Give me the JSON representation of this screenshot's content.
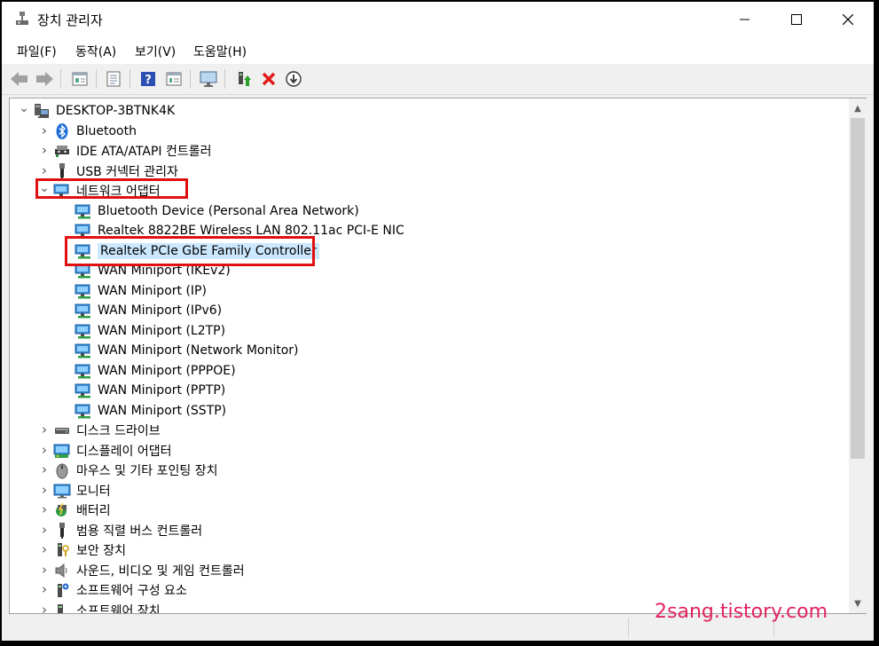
{
  "window": {
    "title": "장치 관리자"
  },
  "menu": [
    "파일(F)",
    "동작(A)",
    "보기(V)",
    "도움말(H)"
  ],
  "toolbar": [
    "back-icon",
    "forward-icon",
    "properties-icon",
    "device-list-icon",
    "help-icon",
    "view-icon",
    "monitor-scan-icon",
    "update-driver-icon",
    "uninstall-icon",
    "disable-icon"
  ],
  "tree": {
    "root": "DESKTOP-3BTNK4K",
    "items": [
      {
        "label": "Bluetooth",
        "level": 1,
        "icon": "bluetooth-icon",
        "expanded": false
      },
      {
        "label": "IDE ATA/ATAPI 컨트롤러",
        "level": 1,
        "icon": "ide-controller-icon",
        "expanded": false
      },
      {
        "label": "USB 커넥터 관리자",
        "level": 1,
        "icon": "usb-connector-icon",
        "expanded": false
      },
      {
        "label": "네트워크 어댑터",
        "level": 1,
        "icon": "network-adapter-icon",
        "expanded": true
      },
      {
        "label": "Bluetooth Device (Personal Area Network)",
        "level": 2,
        "icon": "network-adapter-icon"
      },
      {
        "label": "Realtek 8822BE Wireless LAN 802.11ac PCI-E NIC",
        "level": 2,
        "icon": "network-adapter-icon"
      },
      {
        "label": "Realtek PCIe GbE Family Controller",
        "level": 2,
        "icon": "network-adapter-icon",
        "selected": true
      },
      {
        "label": "WAN Miniport (IKEv2)",
        "level": 2,
        "icon": "network-adapter-icon"
      },
      {
        "label": "WAN Miniport (IP)",
        "level": 2,
        "icon": "network-adapter-icon"
      },
      {
        "label": "WAN Miniport (IPv6)",
        "level": 2,
        "icon": "network-adapter-icon"
      },
      {
        "label": "WAN Miniport (L2TP)",
        "level": 2,
        "icon": "network-adapter-icon"
      },
      {
        "label": "WAN Miniport (Network Monitor)",
        "level": 2,
        "icon": "network-adapter-icon"
      },
      {
        "label": "WAN Miniport (PPPOE)",
        "level": 2,
        "icon": "network-adapter-icon"
      },
      {
        "label": "WAN Miniport (PPTP)",
        "level": 2,
        "icon": "network-adapter-icon"
      },
      {
        "label": "WAN Miniport (SSTP)",
        "level": 2,
        "icon": "network-adapter-icon"
      },
      {
        "label": "디스크 드라이브",
        "level": 1,
        "icon": "disk-drive-icon",
        "expanded": false
      },
      {
        "label": "디스플레이 어댑터",
        "level": 1,
        "icon": "display-adapter-icon",
        "expanded": false
      },
      {
        "label": "마우스 및 기타 포인팅 장치",
        "level": 1,
        "icon": "mouse-icon",
        "expanded": false
      },
      {
        "label": "모니터",
        "level": 1,
        "icon": "monitor-icon",
        "expanded": false
      },
      {
        "label": "배터리",
        "level": 1,
        "icon": "battery-icon",
        "expanded": false
      },
      {
        "label": "범용 직렬 버스 컨트롤러",
        "level": 1,
        "icon": "usb-controller-icon",
        "expanded": false
      },
      {
        "label": "보안 장치",
        "level": 1,
        "icon": "security-device-icon",
        "expanded": false
      },
      {
        "label": "사운드, 비디오 및 게임 컨트롤러",
        "level": 1,
        "icon": "sound-icon",
        "expanded": false
      },
      {
        "label": "소프트웨어 구성 요소",
        "level": 1,
        "icon": "software-component-icon",
        "expanded": false
      },
      {
        "label": "소프트웨어 장치",
        "level": 1,
        "icon": "software-device-icon",
        "expanded": false
      }
    ]
  },
  "watermark": "2sang.tistory.com",
  "colors": {
    "selection": "#cce8ff",
    "highlight_box": "#e01010",
    "watermark": "#e0245e"
  }
}
